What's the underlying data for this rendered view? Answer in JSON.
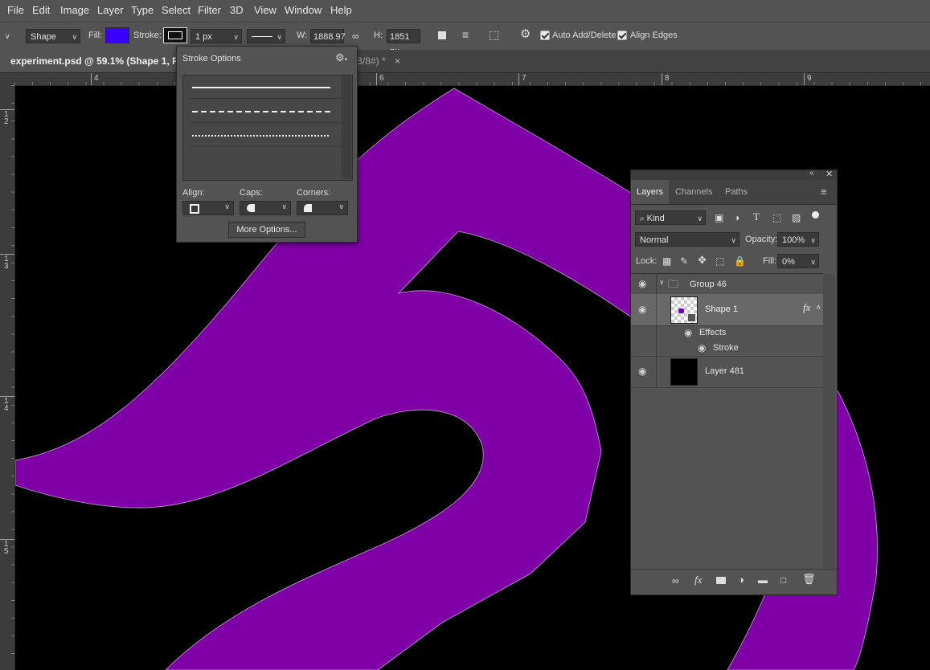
{
  "menu": [
    "File",
    "Edit",
    "Image",
    "Layer",
    "Type",
    "Select",
    "Filter",
    "3D",
    "View",
    "Window",
    "Help"
  ],
  "options": {
    "shape_mode": "Shape",
    "fill_label": "Fill:",
    "fill_color": "#3a00ff",
    "stroke_label": "Stroke:",
    "stroke_width": "1 px",
    "w_label": "W:",
    "w_value": "1888.97",
    "h_label": "H:",
    "h_value": "1851 px",
    "auto_add_delete": "Auto Add/Delete",
    "align_edges": "Align Edges"
  },
  "tabs": {
    "active": "experiment.psd @ 59.1% (Shape 1, RGB,",
    "other": "B/8#) *",
    "close": "×"
  },
  "ruler": {
    "top": [
      "4",
      "5",
      "6",
      "7",
      "8",
      "9"
    ],
    "left": [
      "1\n2",
      "1\n3",
      "1\n4",
      "1\n5"
    ]
  },
  "stroke_options": {
    "title": "Stroke Options",
    "align_label": "Align:",
    "caps_label": "Caps:",
    "corners_label": "Corners:",
    "more_button": "More Options..."
  },
  "layers": {
    "tabs": [
      "Layers",
      "Channels",
      "Paths"
    ],
    "filter_kind": "Kind",
    "blend_mode": "Normal",
    "opacity_label": "Opacity:",
    "opacity_value": "100%",
    "lock_label": "Lock:",
    "fill_label": "Fill:",
    "fill_value": "0%",
    "group_name": "Group 46",
    "shape_name": "Shape 1",
    "fx": "fx",
    "effects_label": "Effects",
    "stroke_label": "Stroke",
    "layer_name": "Layer 481"
  },
  "colors": {
    "shape_purple": "#8000a8",
    "canvas": "#000000",
    "ui_bg": "#535353"
  }
}
